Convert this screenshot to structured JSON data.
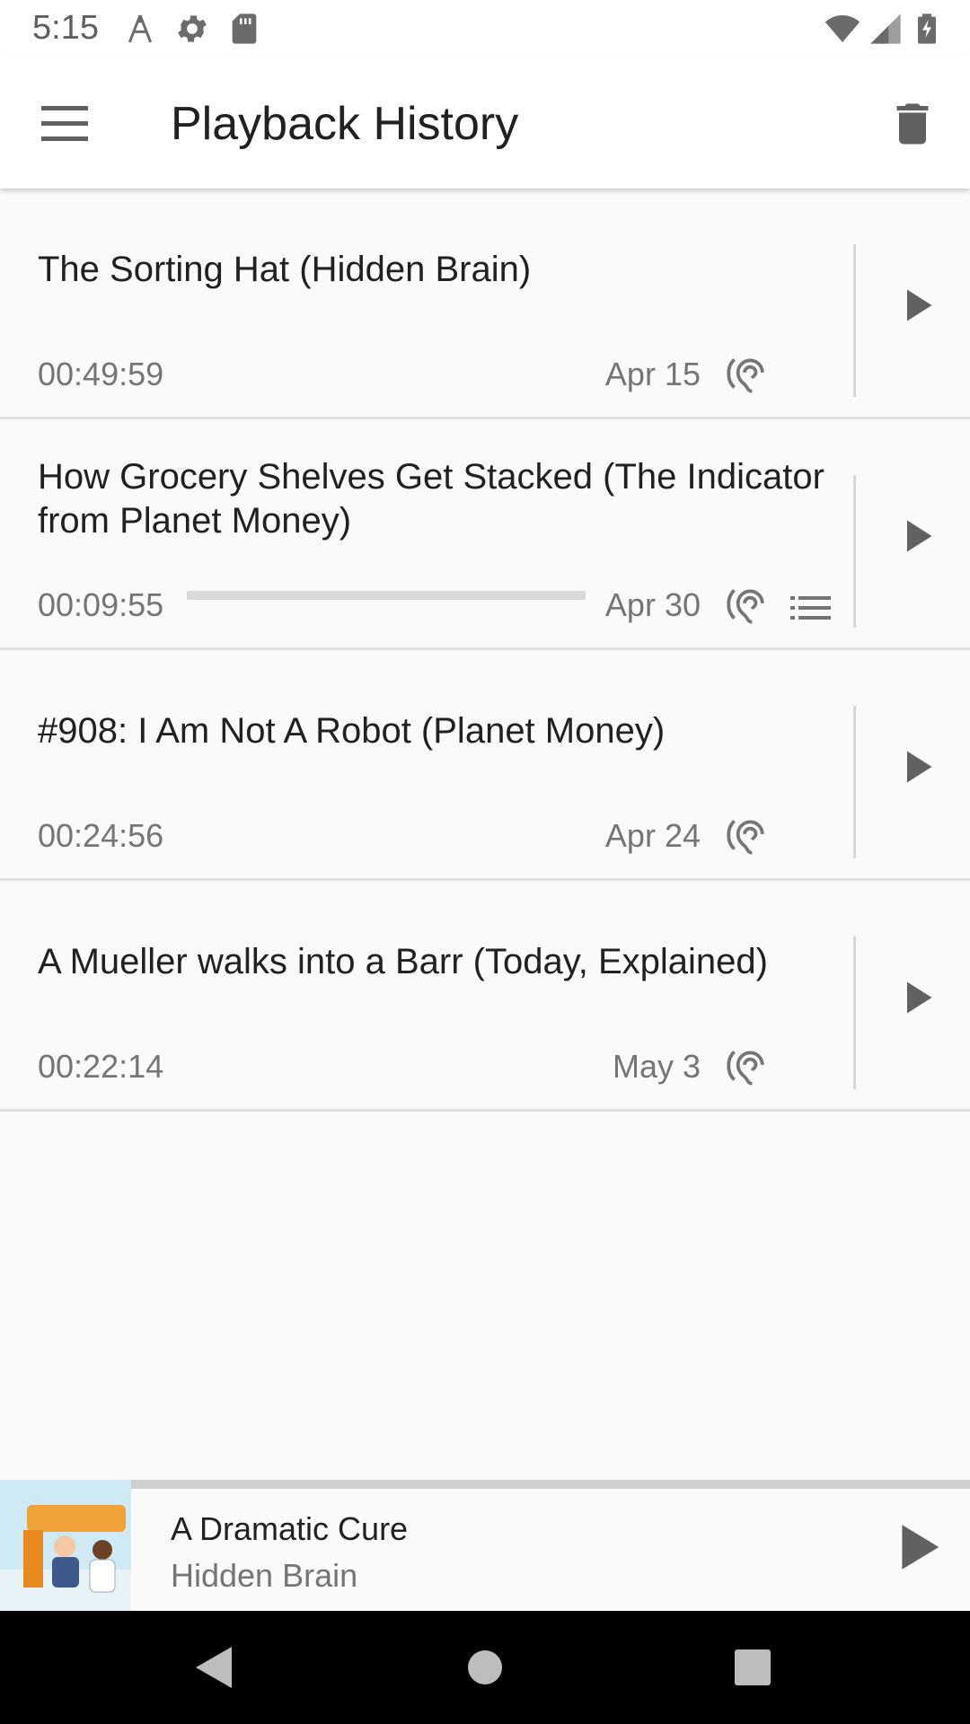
{
  "status_bar": {
    "time": "5:15",
    "icons": [
      "antenna-icon",
      "gear-icon",
      "sd-card-icon",
      "wifi-icon",
      "signal-icon",
      "battery-icon"
    ]
  },
  "app_bar": {
    "title": "Playback History",
    "menu_icon": "hamburger-menu-icon",
    "delete_icon": "trash-icon"
  },
  "history": [
    {
      "title": "The Sorting Hat (Hidden Brain)",
      "duration": "00:49:59",
      "date": "Apr 15",
      "progress": null,
      "queued": false
    },
    {
      "title": "How Grocery Shelves Get Stacked (The Indicator from Planet Money)",
      "duration": "00:09:55",
      "date": "Apr 30",
      "progress": 0,
      "queued": true
    },
    {
      "title": "#908: I Am Not A Robot (Planet Money)",
      "duration": "00:24:56",
      "date": "Apr 24",
      "progress": null,
      "queued": false
    },
    {
      "title": "A Mueller walks into a Barr (Today, Explained)",
      "duration": "00:22:14",
      "date": "May 3",
      "progress": null,
      "queued": false
    }
  ],
  "mini_player": {
    "title": "A Dramatic Cure",
    "podcast": "Hidden Brain"
  },
  "colors": {
    "background": "#fafafa",
    "app_bar": "#ffffff",
    "primary_text": "#212121",
    "secondary_text": "#757575",
    "icon": "#616161",
    "nav_bar": "#000000"
  }
}
